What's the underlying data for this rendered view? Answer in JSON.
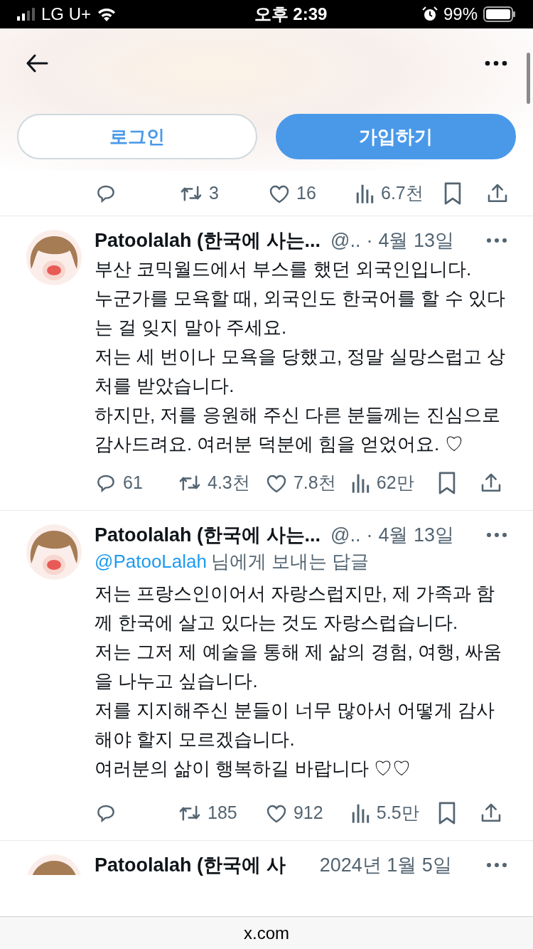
{
  "status_bar": {
    "carrier": "LG U+",
    "time": "오후 2:39",
    "battery": "99%"
  },
  "header": {
    "buttons": [
      {
        "kind": "outline",
        "label": "로그인"
      },
      {
        "kind": "filled",
        "label": "가입하기"
      }
    ]
  },
  "previous_actions": [
    {
      "kind": "reply"
    },
    {
      "kind": "retweet",
      "count": "3"
    },
    {
      "kind": "like",
      "count": "16"
    },
    {
      "kind": "views",
      "count": "6.7천"
    },
    {
      "kind": "bookmark"
    },
    {
      "kind": "share"
    }
  ],
  "tweets": [
    {
      "name": "Patoolalah (한국에 사는...",
      "handle": "@..",
      "separator": "·",
      "date": "4월 13일",
      "body": [
        "부산 코믹월드에서 부스를 했던 외국인입니다.",
        "누군가를 모욕할 때, 외국인도 한국어를 할 수 있다는 걸 잊지 말아 주세요.",
        "저는 세 번이나 모욕을 당했고, 정말 실망스럽고 상처를 받았습니다.",
        "하지만, 저를 응원해 주신 다른 분들께는 진심으로 감사드려요. 여러분 덕분에 힘을 얻었어요. ♡"
      ],
      "actions": [
        {
          "kind": "reply",
          "count": "61"
        },
        {
          "kind": "retweet",
          "count": "4.3천"
        },
        {
          "kind": "like",
          "count": "7.8천"
        },
        {
          "kind": "views",
          "count": "62만"
        },
        {
          "kind": "bookmark"
        },
        {
          "kind": "share"
        }
      ]
    },
    {
      "name": "Patoolalah (한국에 사는...",
      "handle": "@..",
      "separator": "·",
      "date": "4월 13일",
      "reply_to": {
        "mention": "@PatooLalah",
        "text": "님에게 보내는 답글"
      },
      "body": [
        "저는 프랑스인이어서 자랑스럽지만, 제 가족과 함께 한국에 살고 있다는 것도 자랑스럽습니다.",
        "저는 그저 제 예술을 통해 제 삶의 경험, 여행, 싸움을 나누고 싶습니다.",
        "저를 지지해주신 분들이 너무 많아서 어떻게 감사해야 할지 모르겠습니다.",
        "여러분의 삶이 행복하길 바랍니다 ♡♡"
      ],
      "actions": [
        {
          "kind": "reply"
        },
        {
          "kind": "retweet",
          "count": "185"
        },
        {
          "kind": "like",
          "count": "912"
        },
        {
          "kind": "views",
          "count": "5.5만"
        },
        {
          "kind": "bookmark"
        },
        {
          "kind": "share"
        }
      ]
    },
    {
      "name": "Patoolalah (한국에 사",
      "date": "2024년 1월 5일"
    }
  ],
  "browser_bar": {
    "url": "x.com"
  }
}
